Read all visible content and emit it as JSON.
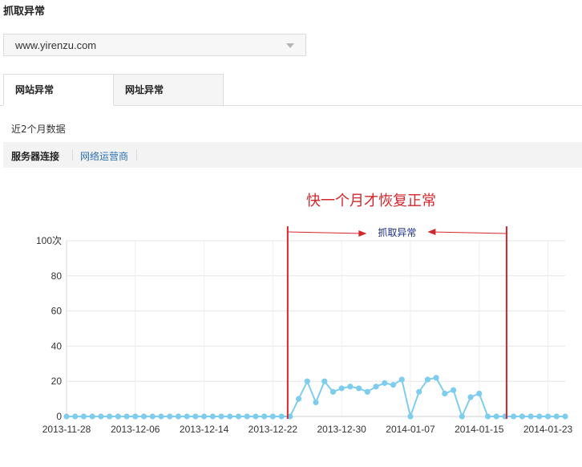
{
  "page": {
    "title": "抓取异常"
  },
  "site_select": {
    "value": "www.yirenzu.com"
  },
  "tabs": [
    {
      "label": "网站异常"
    },
    {
      "label": "网址异常"
    }
  ],
  "range_note": "近2个月数据",
  "subnav": [
    {
      "label": "服务器连接"
    },
    {
      "label": "网络运营商"
    }
  ],
  "annotations": {
    "main": "快一个月才恢复正常",
    "bracket": "抓取异常",
    "color": "#d2262b"
  },
  "colors": {
    "series": "#7fcdee",
    "link": "#2a6fb5"
  },
  "chart_data": {
    "type": "line",
    "ylim": [
      0,
      100
    ],
    "y_ticks": [
      "0",
      "20",
      "40",
      "60",
      "80",
      "100次"
    ],
    "x_tick_labels": [
      "2013-11-28",
      "2013-12-06",
      "2013-12-14",
      "2013-12-22",
      "2013-12-30",
      "2014-01-07",
      "2014-01-15",
      "2014-01-23"
    ],
    "x": [
      "2013-11-28",
      "2013-11-29",
      "2013-11-30",
      "2013-12-01",
      "2013-12-02",
      "2013-12-03",
      "2013-12-04",
      "2013-12-05",
      "2013-12-06",
      "2013-12-07",
      "2013-12-08",
      "2013-12-09",
      "2013-12-10",
      "2013-12-11",
      "2013-12-12",
      "2013-12-13",
      "2013-12-14",
      "2013-12-15",
      "2013-12-16",
      "2013-12-17",
      "2013-12-18",
      "2013-12-19",
      "2013-12-20",
      "2013-12-21",
      "2013-12-22",
      "2013-12-23",
      "2013-12-24",
      "2013-12-25",
      "2013-12-26",
      "2013-12-27",
      "2013-12-28",
      "2013-12-29",
      "2013-12-30",
      "2013-12-31",
      "2014-01-01",
      "2014-01-02",
      "2014-01-03",
      "2014-01-04",
      "2014-01-05",
      "2014-01-06",
      "2014-01-07",
      "2014-01-08",
      "2014-01-09",
      "2014-01-10",
      "2014-01-11",
      "2014-01-12",
      "2014-01-13",
      "2014-01-14",
      "2014-01-15",
      "2014-01-16",
      "2014-01-17",
      "2014-01-18",
      "2014-01-19",
      "2014-01-20",
      "2014-01-21",
      "2014-01-22",
      "2014-01-23",
      "2014-01-24",
      "2014-01-25"
    ],
    "values": [
      0,
      0,
      0,
      0,
      0,
      0,
      0,
      0,
      0,
      0,
      0,
      0,
      0,
      0,
      0,
      0,
      0,
      0,
      0,
      0,
      0,
      0,
      0,
      0,
      0,
      0,
      0,
      10,
      20,
      8,
      20,
      14,
      16,
      17,
      16,
      14,
      17,
      19,
      18,
      21,
      0,
      14,
      21,
      22,
      13,
      15,
      0,
      11,
      13,
      0,
      0,
      0,
      0,
      0,
      0,
      0,
      0,
      0,
      0
    ],
    "anomaly_start": "2013-12-24",
    "anomaly_end": "2014-01-18",
    "grid": true
  }
}
